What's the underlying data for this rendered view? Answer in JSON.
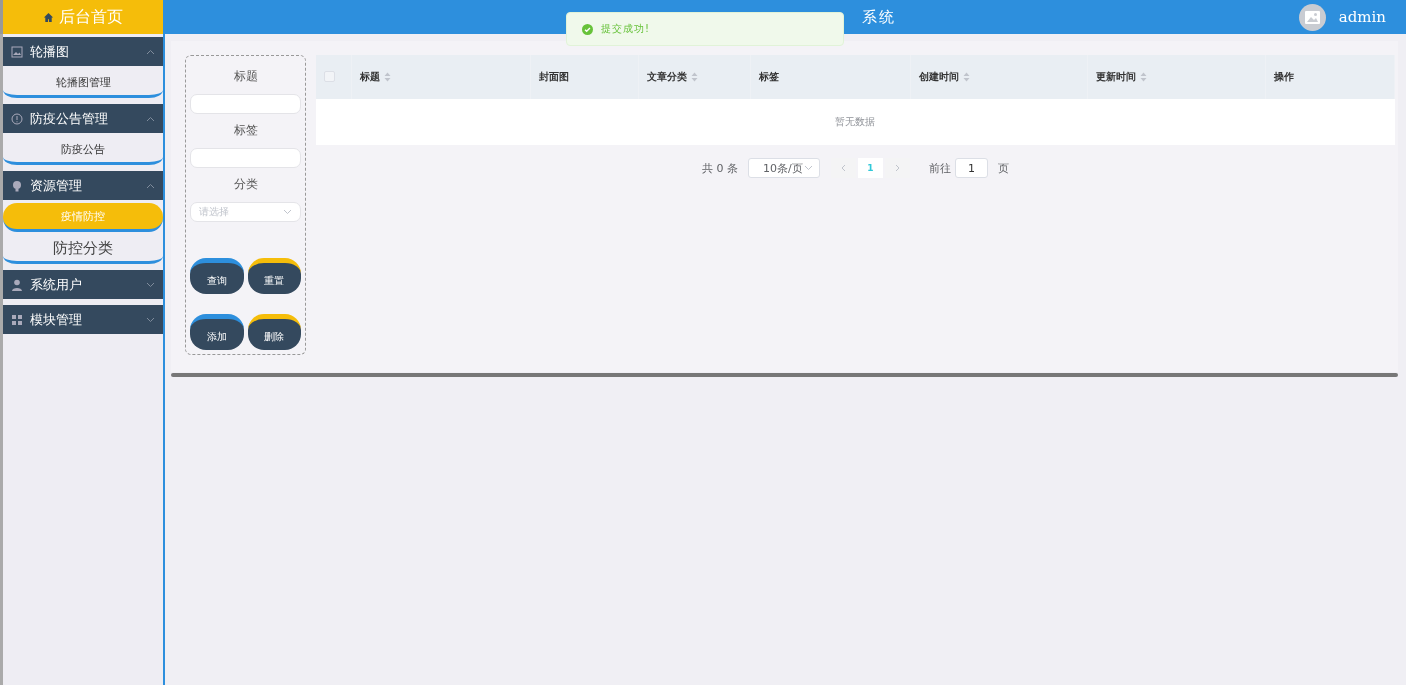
{
  "header": {
    "title": "系统",
    "user": "admin"
  },
  "toast": {
    "kind": "success",
    "message": "提交成功!"
  },
  "sidebar": {
    "home": "后台首页",
    "groups": [
      {
        "title": "轮播图",
        "expanded": true,
        "items": [
          {
            "label": "轮播图管理",
            "selected": false,
            "hovered": false
          }
        ]
      },
      {
        "title": "防疫公告管理",
        "expanded": true,
        "items": [
          {
            "label": "防疫公告",
            "selected": false,
            "hovered": false
          }
        ]
      },
      {
        "title": "资源管理",
        "expanded": true,
        "items": [
          {
            "label": "疫情防控",
            "selected": true,
            "hovered": false
          },
          {
            "label": "防控分类",
            "selected": false,
            "hovered": true
          }
        ]
      },
      {
        "title": "系统用户",
        "expanded": false
      },
      {
        "title": "模块管理",
        "expanded": false
      }
    ]
  },
  "search": {
    "fields": [
      {
        "label": "标题",
        "kind": "text"
      },
      {
        "label": "标签",
        "kind": "text"
      },
      {
        "label": "分类",
        "kind": "select",
        "placeholder": "请选择"
      }
    ],
    "buttons": [
      {
        "label": "查询",
        "color": "#2d8fdd"
      },
      {
        "label": "重置",
        "color": "#f5bd0a"
      },
      {
        "label": "添加",
        "color": "#2d8fdd"
      },
      {
        "label": "删除",
        "color": "#f5bd0a"
      }
    ]
  },
  "table": {
    "select_all": {
      "checked": false
    },
    "columns": [
      {
        "label": "标题",
        "sortable": true
      },
      {
        "label": "封面图",
        "sortable": false
      },
      {
        "label": "文章分类",
        "sortable": true
      },
      {
        "label": "标签",
        "sortable": false
      },
      {
        "label": "创建时间",
        "sortable": true
      },
      {
        "label": "更新时间",
        "sortable": true
      },
      {
        "label": "操作",
        "sortable": false
      }
    ],
    "empty_text": "暂无数据"
  },
  "pagination": {
    "total": "共 0 条",
    "page_size": "10条/页",
    "pages": [
      {
        "label": "1",
        "selected": true
      }
    ],
    "goto_label": "前往",
    "goto_value": "1",
    "page_unit": "页"
  }
}
